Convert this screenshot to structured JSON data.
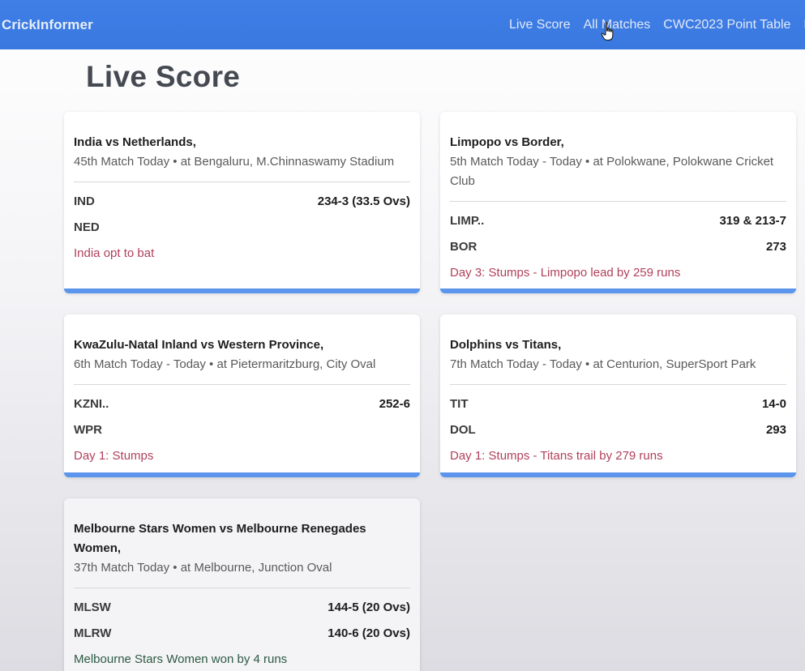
{
  "nav": {
    "brand": "CrickInformer",
    "links": [
      "Live Score",
      "All Matches",
      "CWC2023 Point Table",
      "Ho"
    ]
  },
  "page": {
    "title": "Live Score"
  },
  "matches": [
    {
      "title": "India vs Netherlands,",
      "subtitle": "45th Match Today • at Bengaluru, M.Chinnaswamy Stadium",
      "teams": [
        {
          "name": "IND",
          "score": "234-3 (33.5 Ovs)"
        },
        {
          "name": "NED",
          "score": ""
        }
      ],
      "status": "India opt to bat"
    },
    {
      "title": "Limpopo vs Border,",
      "subtitle": "5th Match Today - Today • at Polokwane, Polokwane Cricket Club",
      "teams": [
        {
          "name": "LIMP..",
          "score": "319 & 213-7"
        },
        {
          "name": "BOR",
          "score": "273"
        }
      ],
      "status": "Day 3: Stumps - Limpopo lead by 259 runs"
    },
    {
      "title": "KwaZulu-Natal Inland vs Western Province,",
      "subtitle": "6th Match Today - Today • at Pietermaritzburg, City Oval",
      "teams": [
        {
          "name": "KZNI..",
          "score": "252-6"
        },
        {
          "name": "WPR",
          "score": ""
        }
      ],
      "status": "Day 1: Stumps"
    },
    {
      "title": "Dolphins vs Titans,",
      "subtitle": "7th Match Today - Today • at Centurion, SuperSport Park",
      "teams": [
        {
          "name": "TIT",
          "score": "14-0"
        },
        {
          "name": "DOL",
          "score": "293"
        }
      ],
      "status": "Day 1: Stumps - Titans trail by 279 runs"
    },
    {
      "title": "Melbourne Stars Women vs Melbourne Renegades Women,",
      "subtitle": "37th Match Today • at Melbourne, Junction Oval",
      "teams": [
        {
          "name": "MLSW",
          "score": "144-5 (20 Ovs)"
        },
        {
          "name": "MLRW",
          "score": "140-6 (20 Ovs)"
        }
      ],
      "status": "Melbourne Stars Women won by 4 runs"
    }
  ],
  "colors": {
    "navbar": "#3f7fe6",
    "card_accent": "#5b95ec",
    "status_live": "#b1405a",
    "status_result": "#2d5a44"
  }
}
